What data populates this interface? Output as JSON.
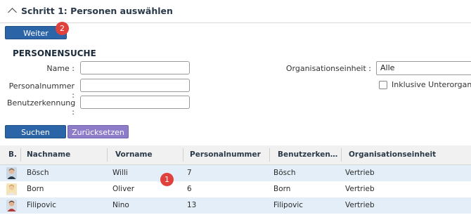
{
  "section": {
    "title": "Schritt 1: Personen auswählen"
  },
  "toolbar": {
    "weiter_label": "Weiter",
    "weiter_badge": "2"
  },
  "search": {
    "title": "PERSONENSUCHE",
    "name_label": "Name :",
    "name_value": "",
    "personalnummer_label": "Personalnummer :",
    "personalnummer_value": "",
    "benutzerkennung_label": "Benutzerkennung :",
    "benutzerkennung_value": "",
    "org_label": "Organisationseinheit :",
    "org_value": "Alle",
    "include_sub_label": "Inklusive Unterorganisat",
    "search_button": "Suchen",
    "reset_button": "Zurücksetzen"
  },
  "table": {
    "headers": [
      "B.",
      "Nachname",
      "Vorname",
      "Personalnummer",
      "Benutzerken…",
      "Organisationseinheit"
    ],
    "rows": [
      {
        "nachname": "Bösch",
        "vorname": "Willi",
        "personalnummer": "7",
        "benutzer": "Bösch",
        "org": "Vertrieb"
      },
      {
        "nachname": "Born",
        "vorname": "Oliver",
        "personalnummer": "6",
        "benutzer": "Born",
        "org": "Vertrieb"
      },
      {
        "nachname": "Filipovic",
        "vorname": "Nino",
        "personalnummer": "13",
        "benutzer": "Filipovic",
        "org": "Vertrieb"
      }
    ],
    "row_badge": "1"
  },
  "colors": {
    "primary": "#2c64a8",
    "secondary": "#8d7cc8",
    "badge": "#e0413d",
    "row_highlight": "#e3eef8"
  }
}
